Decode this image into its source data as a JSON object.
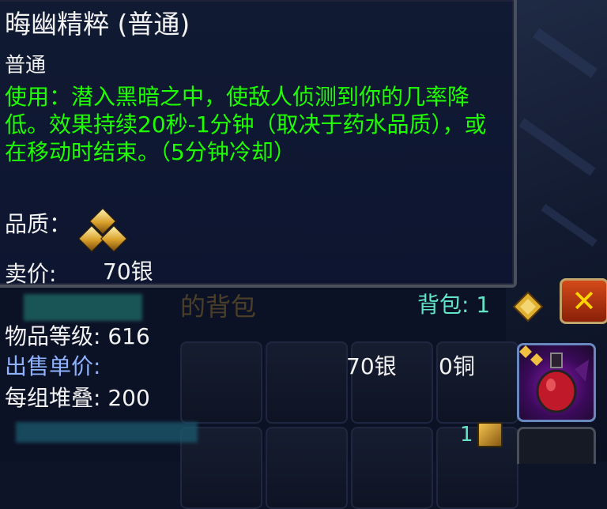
{
  "tooltip": {
    "title": "晦幽精粹 (普通)",
    "quality_text": "普通",
    "use_text": "使用：潜入黑暗之中，使敌人侦测到你的几率降低。效果持续20秒-1分钟（取决于药水品质），或在移动时结束。（5分钟冷却）",
    "quality_label": "品质：",
    "quality_tier": 3,
    "sell_label": "卖价:",
    "sell_value": "70银"
  },
  "bag_panel": {
    "faint_title": "的背包",
    "bag_count": "背包: 1",
    "item_level": "物品等级: 616",
    "unit_price_label": "出售单价:",
    "unit_price_silver": "70银",
    "unit_price_copper": "0铜",
    "stack": "每组堆叠: 200",
    "slot_count_mark": "1"
  },
  "colors": {
    "green": "#1eff00",
    "cyan": "#62e5c7",
    "label_blue": "#8fb2ff"
  },
  "icons": [
    "close-icon",
    "gold-coin-icon",
    "potion-icon",
    "quality-gem-icon"
  ]
}
